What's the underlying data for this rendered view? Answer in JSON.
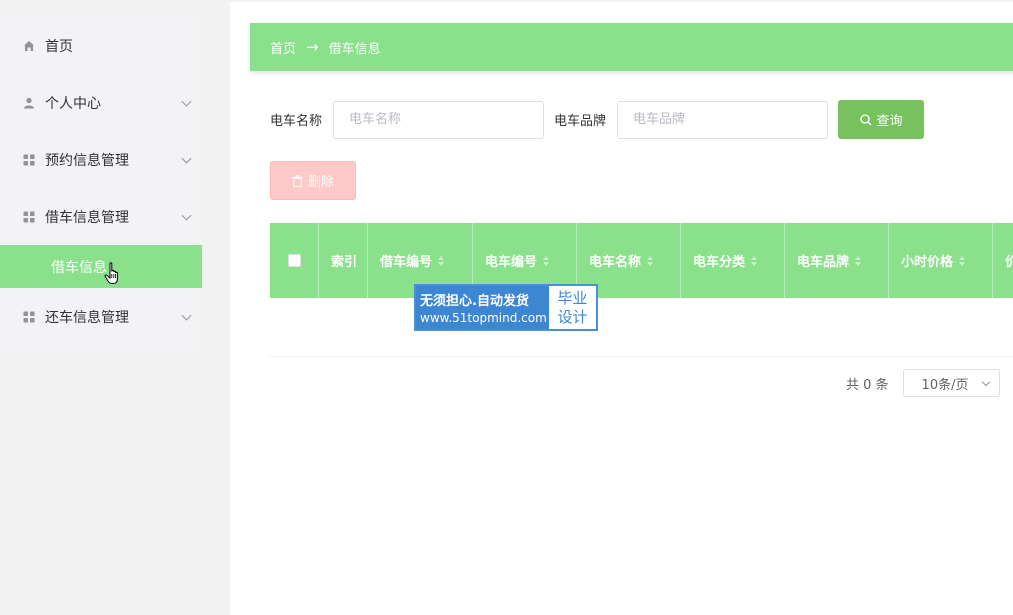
{
  "sidebar": {
    "items": [
      {
        "label": "首页",
        "icon": "home-icon",
        "has_children": false
      },
      {
        "label": "个人中心",
        "icon": "user-icon",
        "has_children": true
      },
      {
        "label": "预约信息管理",
        "icon": "grid-icon",
        "has_children": true
      },
      {
        "label": "借车信息管理",
        "icon": "grid-icon",
        "has_children": true,
        "expanded": true,
        "children": [
          {
            "label": "借车信息",
            "active": true
          }
        ]
      },
      {
        "label": "还车信息管理",
        "icon": "grid-icon",
        "has_children": true
      }
    ]
  },
  "breadcrumb": {
    "home": "首页",
    "separator": "→",
    "current": "借车信息"
  },
  "search": {
    "name_label": "电车名称",
    "name_placeholder": "电车名称",
    "brand_label": "电车品牌",
    "brand_placeholder": "电车品牌",
    "search_button": "查询"
  },
  "actions": {
    "delete_button": "删除"
  },
  "table": {
    "columns": [
      "索引",
      "借车编号",
      "电车编号",
      "电车名称",
      "电车分类",
      "电车品牌",
      "小时价格",
      "价"
    ],
    "rows": []
  },
  "pagination": {
    "total": "共 0 条",
    "page_size": "10条/页"
  },
  "watermark": {
    "line1": "无须担心.自动发货",
    "line2": "www.51topmind.com",
    "badge_line1": "毕业",
    "badge_line2": "设计"
  },
  "colors": {
    "accent_green": "#8be08b",
    "search_green": "#77c15e",
    "delete_pink": "#ffc9c9",
    "watermark_blue": "#3d86d1"
  }
}
